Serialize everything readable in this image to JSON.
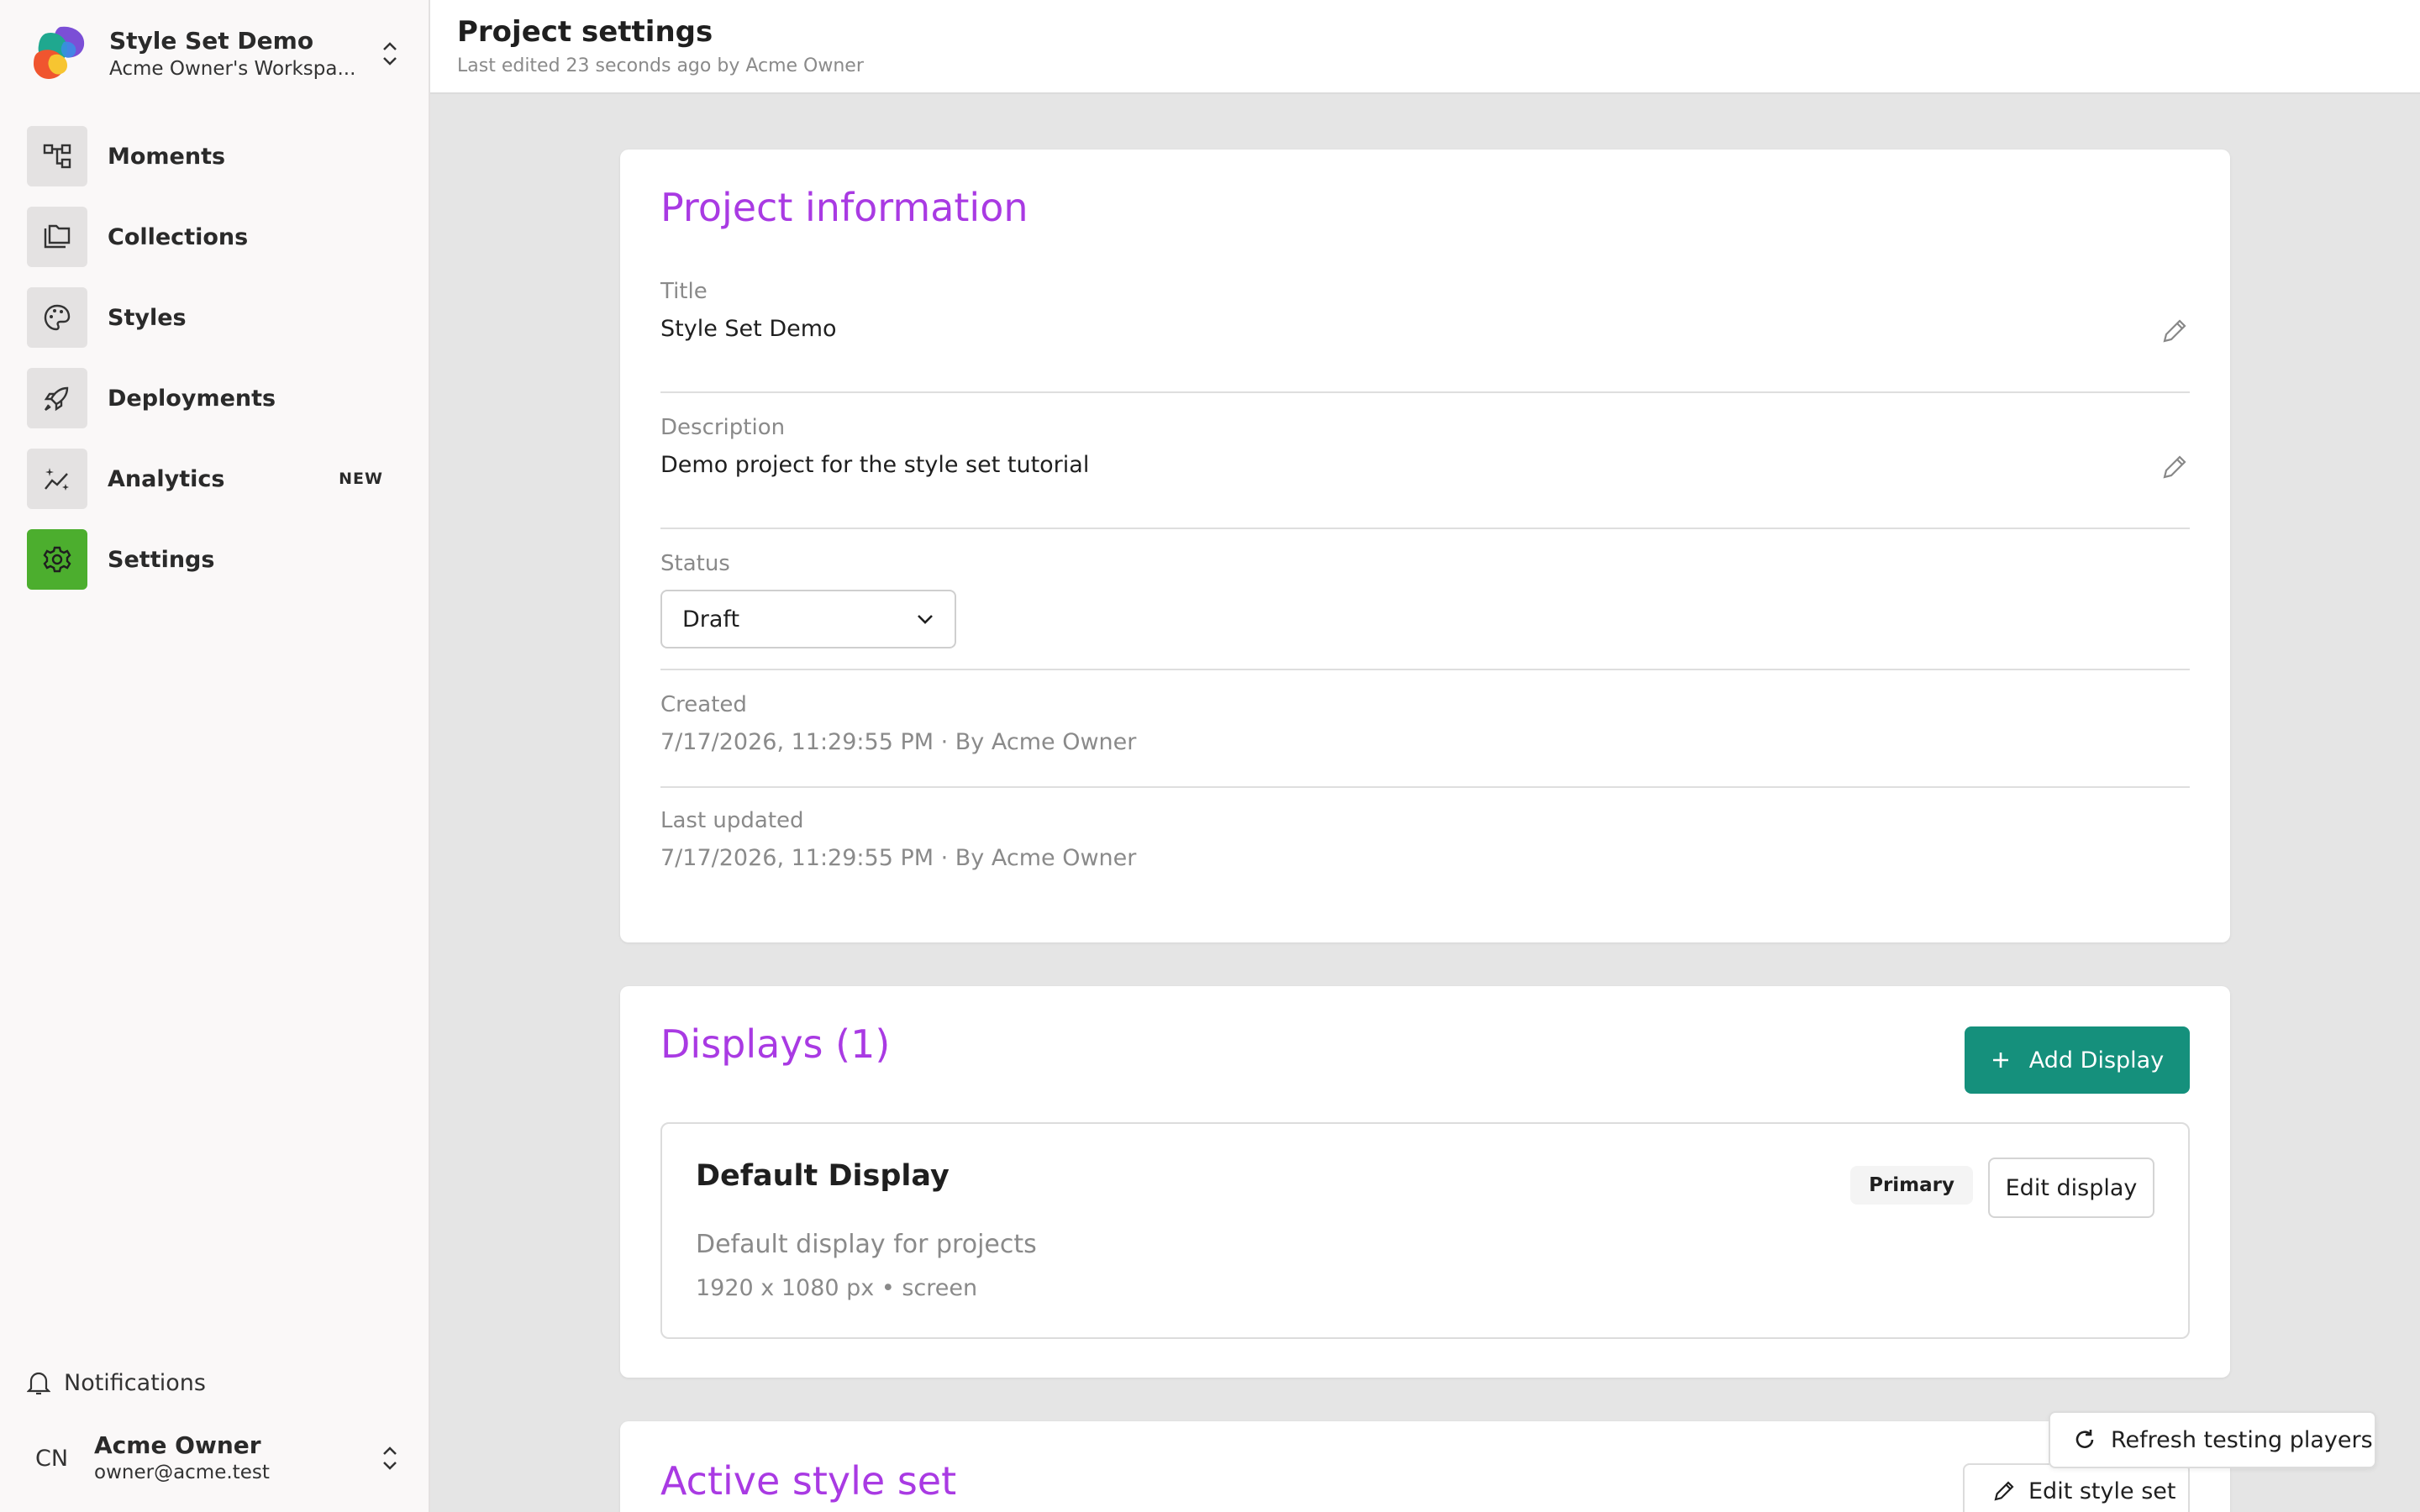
{
  "workspace": {
    "title": "Style Set Demo",
    "subtitle": "Acme Owner's Workspa..."
  },
  "nav": {
    "items": [
      {
        "label": "Moments",
        "icon": "flow-icon"
      },
      {
        "label": "Collections",
        "icon": "folders-icon"
      },
      {
        "label": "Styles",
        "icon": "palette-icon"
      },
      {
        "label": "Deployments",
        "icon": "rocket-icon"
      },
      {
        "label": "Analytics",
        "icon": "sparkle-chart-icon",
        "badge": "NEW"
      },
      {
        "label": "Settings",
        "icon": "gear-icon",
        "active": true
      }
    ]
  },
  "footer": {
    "notifications": "Notifications",
    "user_initials": "CN",
    "user_name": "Acme Owner",
    "user_email": "owner@acme.test"
  },
  "header": {
    "title": "Project settings",
    "subtitle": "Last edited 23 seconds ago by Acme Owner"
  },
  "project_info": {
    "heading": "Project information",
    "title_label": "Title",
    "title_value": "Style Set Demo",
    "description_label": "Description",
    "description_value": "Demo project for the style set tutorial",
    "status_label": "Status",
    "status_value": "Draft",
    "created_label": "Created",
    "created_value": "7/17/2026, 11:29:55 PM · By Acme Owner",
    "updated_label": "Last updated",
    "updated_value": "7/17/2026, 11:29:55 PM · By Acme Owner"
  },
  "displays": {
    "heading": "Displays (1)",
    "add_button": "Add Display",
    "item": {
      "name": "Default Display",
      "badge": "Primary",
      "edit_button": "Edit display",
      "description": "Default display for projects",
      "meta": "1920 x 1080 px • screen"
    }
  },
  "style_set": {
    "heading": "Active style set",
    "edit_button": "Edit style set"
  },
  "refresh_button": "Refresh testing players",
  "colors": {
    "accent": "#a93ae3",
    "primary_button": "#15907c",
    "active_nav": "#4cae2e"
  }
}
